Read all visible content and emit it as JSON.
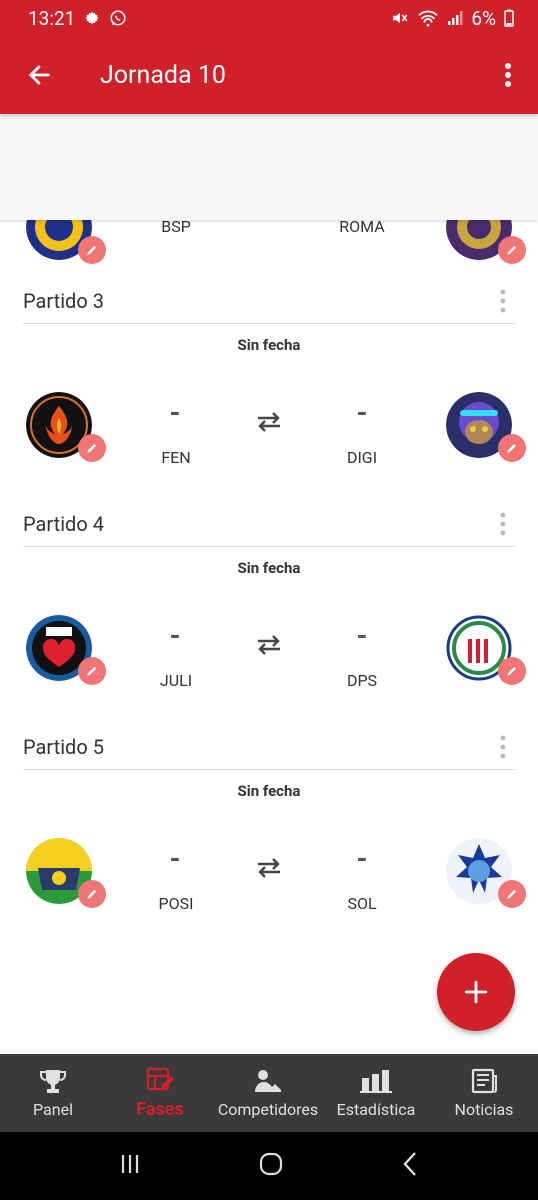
{
  "status_bar": {
    "time": "13:21",
    "battery": "6%"
  },
  "app_bar": {
    "title": "Jornada 10"
  },
  "partial_match": {
    "home_code": "BSP",
    "away_code": "ROMA"
  },
  "matches": [
    {
      "title": "Partido 3",
      "date": "Sin fecha",
      "home_score": "-",
      "away_score": "-",
      "home_code": "FEN",
      "away_code": "DIGI",
      "home_logo": "fenix-logo",
      "away_logo": "cat-helmet-logo"
    },
    {
      "title": "Partido 4",
      "date": "Sin fecha",
      "home_score": "-",
      "away_score": "-",
      "home_code": "JULI",
      "away_code": "DPS",
      "home_logo": "juli-logo",
      "away_logo": "deportivo-splinter-logo"
    },
    {
      "title": "Partido 5",
      "date": "Sin fecha",
      "home_score": "-",
      "away_score": "-",
      "home_code": "POSI",
      "away_code": "SOL",
      "home_logo": "positivos-logo",
      "away_logo": "sol-star-logo"
    }
  ],
  "bottom_nav": [
    {
      "label": "Panel",
      "icon": "trophy-icon"
    },
    {
      "label": "Fases",
      "icon": "phases-icon",
      "active": true
    },
    {
      "label": "Competidores",
      "icon": "competitors-icon"
    },
    {
      "label": "Estadística",
      "icon": "stats-icon"
    },
    {
      "label": "Noticias",
      "icon": "news-icon"
    }
  ],
  "colors": {
    "primary": "#d0202a",
    "edit_badge": "#f07575",
    "nav_bg": "#3a3a3a"
  }
}
